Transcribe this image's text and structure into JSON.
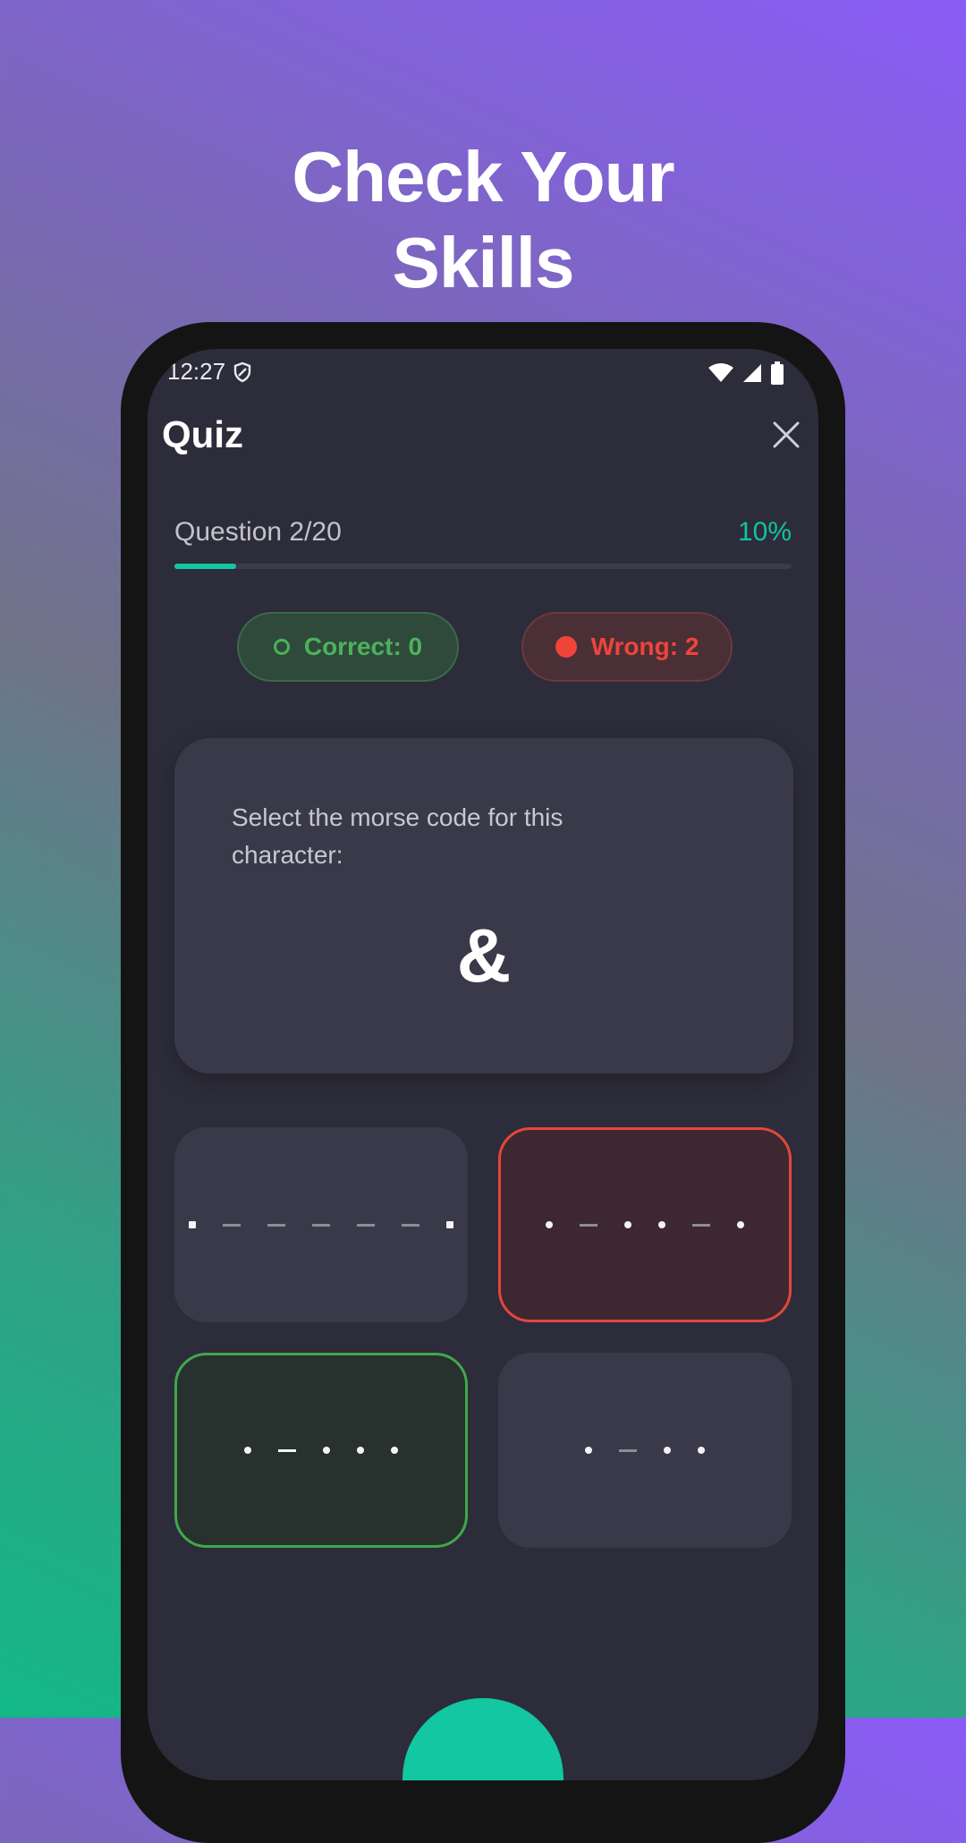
{
  "headline": {
    "line1": "Check Your",
    "line2": "Skills"
  },
  "status_bar": {
    "time": "12:27",
    "icons": [
      "shield-icon",
      "wifi-icon",
      "signal-icon",
      "battery-icon"
    ]
  },
  "app_bar": {
    "title": "Quiz",
    "close_icon": "close-icon"
  },
  "progress": {
    "label": "Question 2/20",
    "percent_text": "10%",
    "fraction": 0.1
  },
  "score": {
    "correct": "Correct: 0",
    "wrong": "Wrong: 2"
  },
  "question": {
    "prompt": "Select the morse code for this character:",
    "character": "&"
  },
  "options": [
    {
      "code": ".-----.",
      "state": "default"
    },
    {
      "code": ".-..-.",
      "state": "wrong"
    },
    {
      "code": ".-...",
      "state": "correct"
    },
    {
      "code": ".-..",
      "state": "default"
    }
  ],
  "colors": {
    "accent": "#12c7a2",
    "correct": "#40a84c",
    "wrong": "#e4463c",
    "card": "#3a3949",
    "screen": "#2d2c3a"
  }
}
